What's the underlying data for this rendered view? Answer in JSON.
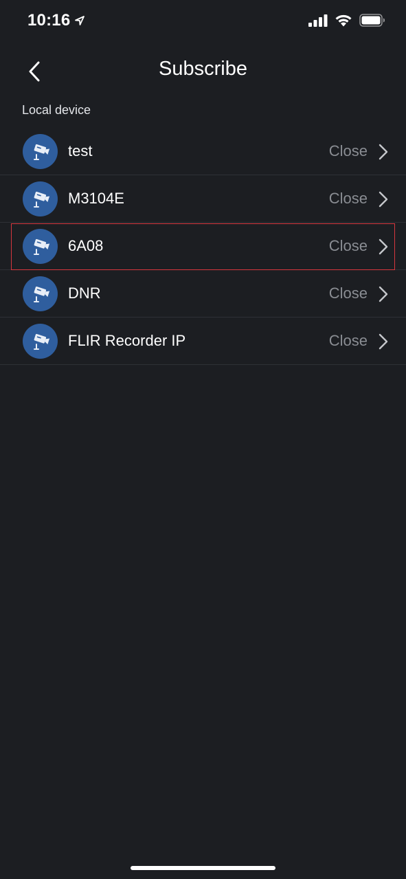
{
  "status_bar": {
    "time": "10:16",
    "location_icon": "location-arrow-icon",
    "signal_icon": "cellular-signal-icon",
    "wifi_icon": "wifi-icon",
    "battery_icon": "battery-icon"
  },
  "nav": {
    "title": "Subscribe",
    "back_icon": "chevron-left-icon"
  },
  "section": {
    "header": "Local device"
  },
  "devices": [
    {
      "name": "test",
      "status": "Close",
      "icon": "camera-icon",
      "selected": false
    },
    {
      "name": "M3104E",
      "status": "Close",
      "icon": "camera-icon",
      "selected": false
    },
    {
      "name": "6A08",
      "status": "Close",
      "icon": "camera-icon",
      "selected": true
    },
    {
      "name": "DNR",
      "status": "Close",
      "icon": "camera-icon",
      "selected": false
    },
    {
      "name": "FLIR Recorder IP",
      "status": "Close",
      "icon": "camera-icon",
      "selected": false
    }
  ],
  "colors": {
    "background": "#1c1e22",
    "avatar": "#2f5e9e",
    "highlight": "#d8373e",
    "status_text": "#8a8d93"
  }
}
